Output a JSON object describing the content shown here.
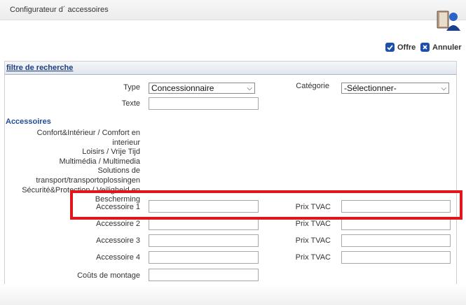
{
  "app": {
    "title": "Configurateur d´ accessoires",
    "logo_icon": "book-person-icon"
  },
  "actions": {
    "offre": {
      "label": "Offre",
      "icon": "check-circle-icon",
      "color": "#1a4fb0"
    },
    "annuler": {
      "label": "Annuler",
      "icon": "close-x-icon",
      "color": "#1a4fb0"
    }
  },
  "panel": {
    "title": "filtre de recherche"
  },
  "filters": {
    "type_label": "Type",
    "type_value": "Concessionnaire",
    "categorie_label": "Catégorie",
    "categorie_value": "-Sélectionner-",
    "texte_label": "Texte",
    "texte_value": ""
  },
  "accessoires": {
    "section_title": "Accessoires",
    "categories": [
      "Confort&Intérieur / Comfort en interieur",
      "Loisirs / Vrije Tijd",
      "Multimédia / Multimedia",
      "Solutions de transport/transportoplossingen",
      "Sécurité&Protection / Veiligheid en Bescherming"
    ],
    "rows": [
      {
        "label": "Accessoire 1",
        "value": "",
        "prix_label": "Prix TVAC",
        "prix_value": ""
      },
      {
        "label": "Accessoire 2",
        "value": "",
        "prix_label": "Prix TVAC",
        "prix_value": ""
      },
      {
        "label": "Accessoire 3",
        "value": "",
        "prix_label": "Prix TVAC",
        "prix_value": ""
      },
      {
        "label": "Accessoire 4",
        "value": "",
        "prix_label": "Prix TVAC",
        "prix_value": ""
      }
    ],
    "couts_label": "Coûts de montage",
    "couts_value": ""
  },
  "colors": {
    "accent": "#1f4d9a",
    "highlight": "#e0161b"
  }
}
